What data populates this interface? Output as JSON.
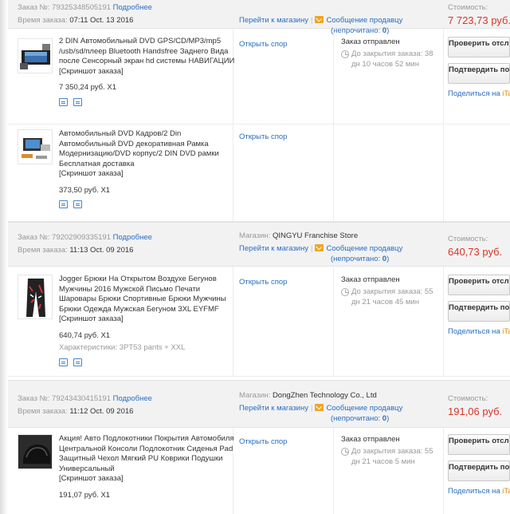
{
  "labels": {
    "order_no": "Заказ №:",
    "order_time": "Время заказа:",
    "details": "Подробнее",
    "store": "Магазин:",
    "go_store": "Перейти к магазину",
    "message_seller": "Сообщение продавцу",
    "unread": "(непрочитано:",
    "unread_end": ")",
    "cost": "Стоимость:",
    "open_dispute": "Открыть спор",
    "order_sent": "Заказ отправлен",
    "screenshot": "[Скриншот заказа]",
    "btn_check": "Проверить отслеживание",
    "btn_confirm": "Подтвердить получение товара",
    "share": "Поделиться на",
    "share_suffix": "iTao"
  },
  "orders": [
    {
      "number": "79325348505191",
      "time": "07:11 Oct. 13 2016",
      "store": "",
      "unread": "0",
      "cost": "7 723,73 руб.",
      "items": [
        {
          "title": "2 DIN Автомобильный DVD GPS/CD/MP3/mp5 /usb/sd/плеер Bluetooth Handsfree Заднего Вида после Сенсорный экран hd системы НАВИГАЦИИ",
          "price": "7 350,24 руб. X1",
          "countdown": "До закрытия заказа: 38 дн 10 часов 52 мин",
          "thumb": "car-dvd-gps-icon"
        },
        {
          "title": "Автомобильный DVD Кадров/2 Din Автомобильный DVD декоративная Рамка Модернизацию/DVD корпус/2 DIN DVD рамки Бесплатная доставка",
          "price": "373,50 руб. X1",
          "thumb": "dvd-frame-icon"
        }
      ]
    },
    {
      "number": "79202909335191",
      "time": "11:13 Oct. 09 2016",
      "store": "QINGYU Franchise Store",
      "unread": "0",
      "cost": "640,73 руб.",
      "items": [
        {
          "title": "Jogger Брюки На Открытом Воздухе Бегунов Мужчины 2016 Мужской Письмо Печати Шаровары Брюки Спортивные Брюки Мужчины Брюки Одежда Мужская Бегуном 3XL EYFMF",
          "price": "640,74 руб. X1",
          "specs": "Характеристики: 3PT53 pants + XXL",
          "countdown": "До закрытия заказа: 55 дн 21 часов 45 мин",
          "thumb": "jogger-pants-icon"
        }
      ]
    },
    {
      "number": "79243430415191",
      "time": "11:12 Oct. 09 2016",
      "store": "DongZhen Technology Co., Ltd",
      "unread": "0",
      "cost": "191,06 руб.",
      "items": [
        {
          "title": "Акция! Авто Подлокотники Покрытия Автомобиля Центральной Консоли Подлокотник Сиденья Pad Защитный Чехол Мягкий PU Коврики Подушки Универсальный",
          "price": "191,07 руб. X1",
          "countdown": "До закрытия заказа: 55 дн 21 часов 5 мин",
          "thumb": "armrest-cover-icon"
        }
      ]
    }
  ]
}
